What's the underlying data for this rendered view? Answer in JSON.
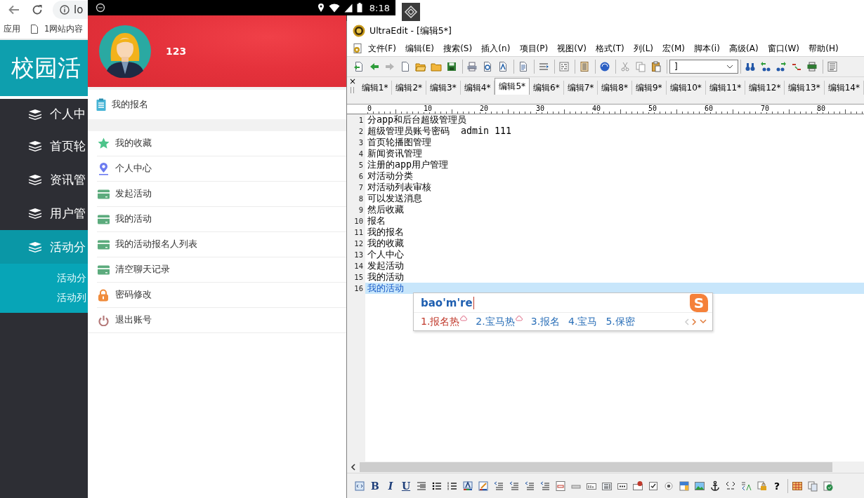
{
  "browser": {
    "address": "lo",
    "bookmarks": [
      {
        "label": "应用",
        "kind": "apps"
      },
      {
        "label": "1网站内容",
        "kind": "page"
      }
    ],
    "site_title": "校园活",
    "sidebar": [
      {
        "label": "个人中",
        "selected": false
      },
      {
        "label": "首页轮",
        "selected": false
      },
      {
        "label": "资讯管",
        "selected": false
      },
      {
        "label": "用户管",
        "selected": false
      },
      {
        "label": "活动分",
        "selected": true,
        "children": [
          {
            "label": "活动分"
          },
          {
            "label": "活动列"
          }
        ]
      }
    ]
  },
  "phone": {
    "time": "8:18",
    "user_name": "123",
    "top_menu": [
      "我的报名"
    ],
    "menu": [
      "我的收藏",
      "个人中心",
      "发起活动",
      "我的活动",
      "我的活动报名人列表",
      "清空聊天记录",
      "密码修改",
      "退出账号"
    ]
  },
  "editor": {
    "title": "UltraEdit - [编辑5*]",
    "menu": [
      "文件(F)",
      "编辑(E)",
      "搜索(S)",
      "插入(n)",
      "项目(P)",
      "视图(V)",
      "格式(T)",
      "列(L)",
      "宏(M)",
      "脚本(i)",
      "高级(A)",
      "窗口(W)",
      "帮助(H)"
    ],
    "find_box": {
      "value": "]"
    },
    "tab_close": "×",
    "tabs": [
      {
        "label": "编辑1*",
        "selected": false
      },
      {
        "label": "编辑2*",
        "selected": false
      },
      {
        "label": "编辑3*",
        "selected": false
      },
      {
        "label": "编辑4*",
        "selected": false
      },
      {
        "label": "编辑5*",
        "selected": true
      },
      {
        "label": "编辑6*",
        "selected": false
      },
      {
        "label": "编辑7*",
        "selected": false
      },
      {
        "label": "编辑8*",
        "selected": false
      },
      {
        "label": "编辑9*",
        "selected": false
      },
      {
        "label": "编辑10*",
        "selected": false
      },
      {
        "label": "编辑11*",
        "selected": false
      },
      {
        "label": "编辑12*",
        "selected": false
      },
      {
        "label": "编辑13*",
        "selected": false
      },
      {
        "label": "编辑14*",
        "selected": false
      }
    ],
    "ruler": [
      "0",
      "10",
      "20",
      "30",
      "40",
      "50",
      "60",
      "70",
      "80"
    ],
    "lines": [
      {
        "number": "1",
        "text": "分app和后台超级管理员",
        "selected": false
      },
      {
        "number": "2",
        "text": "超级管理员账号密码  admin 111",
        "selected": false
      },
      {
        "number": "3",
        "text": "首页轮播图管理",
        "selected": false
      },
      {
        "number": "4",
        "text": "新闻资讯管理",
        "selected": false
      },
      {
        "number": "5",
        "text": "注册的app用户管理",
        "selected": false
      },
      {
        "number": "6",
        "text": "对活动分类",
        "selected": false
      },
      {
        "number": "7",
        "text": "对活动列表审核",
        "selected": false
      },
      {
        "number": "8",
        "text": "可以发送消息",
        "selected": false
      },
      {
        "number": "9",
        "text": "然后收藏",
        "selected": false
      },
      {
        "number": "10",
        "text": "报名",
        "selected": false
      },
      {
        "number": "11",
        "text": "我的报名",
        "selected": false
      },
      {
        "number": "12",
        "text": "我的收藏",
        "selected": false
      },
      {
        "number": "13",
        "text": "个人中心",
        "selected": false
      },
      {
        "number": "14",
        "text": "发起活动",
        "selected": false
      },
      {
        "number": "15",
        "text": "我的活动",
        "selected": false
      },
      {
        "number": "16",
        "text": "我的活动",
        "selected": true
      }
    ],
    "ime": {
      "input": "bao'm're",
      "logo": "S",
      "candidates": [
        {
          "label": "1.报名热",
          "selected": true,
          "kind": "cloud"
        },
        {
          "label": "2.宝马热",
          "selected": false,
          "kind": "cloud"
        },
        {
          "label": "3.报名",
          "selected": false,
          "kind": "plain"
        },
        {
          "label": "4.宝马",
          "selected": false,
          "kind": "plain"
        },
        {
          "label": "5.保密",
          "selected": false,
          "kind": "plain"
        }
      ]
    },
    "format_buttons": [
      {
        "kind": "bold",
        "label": "B"
      },
      {
        "kind": "italic",
        "label": "I"
      },
      {
        "kind": "underline",
        "label": "U"
      }
    ],
    "help_button": "?"
  }
}
